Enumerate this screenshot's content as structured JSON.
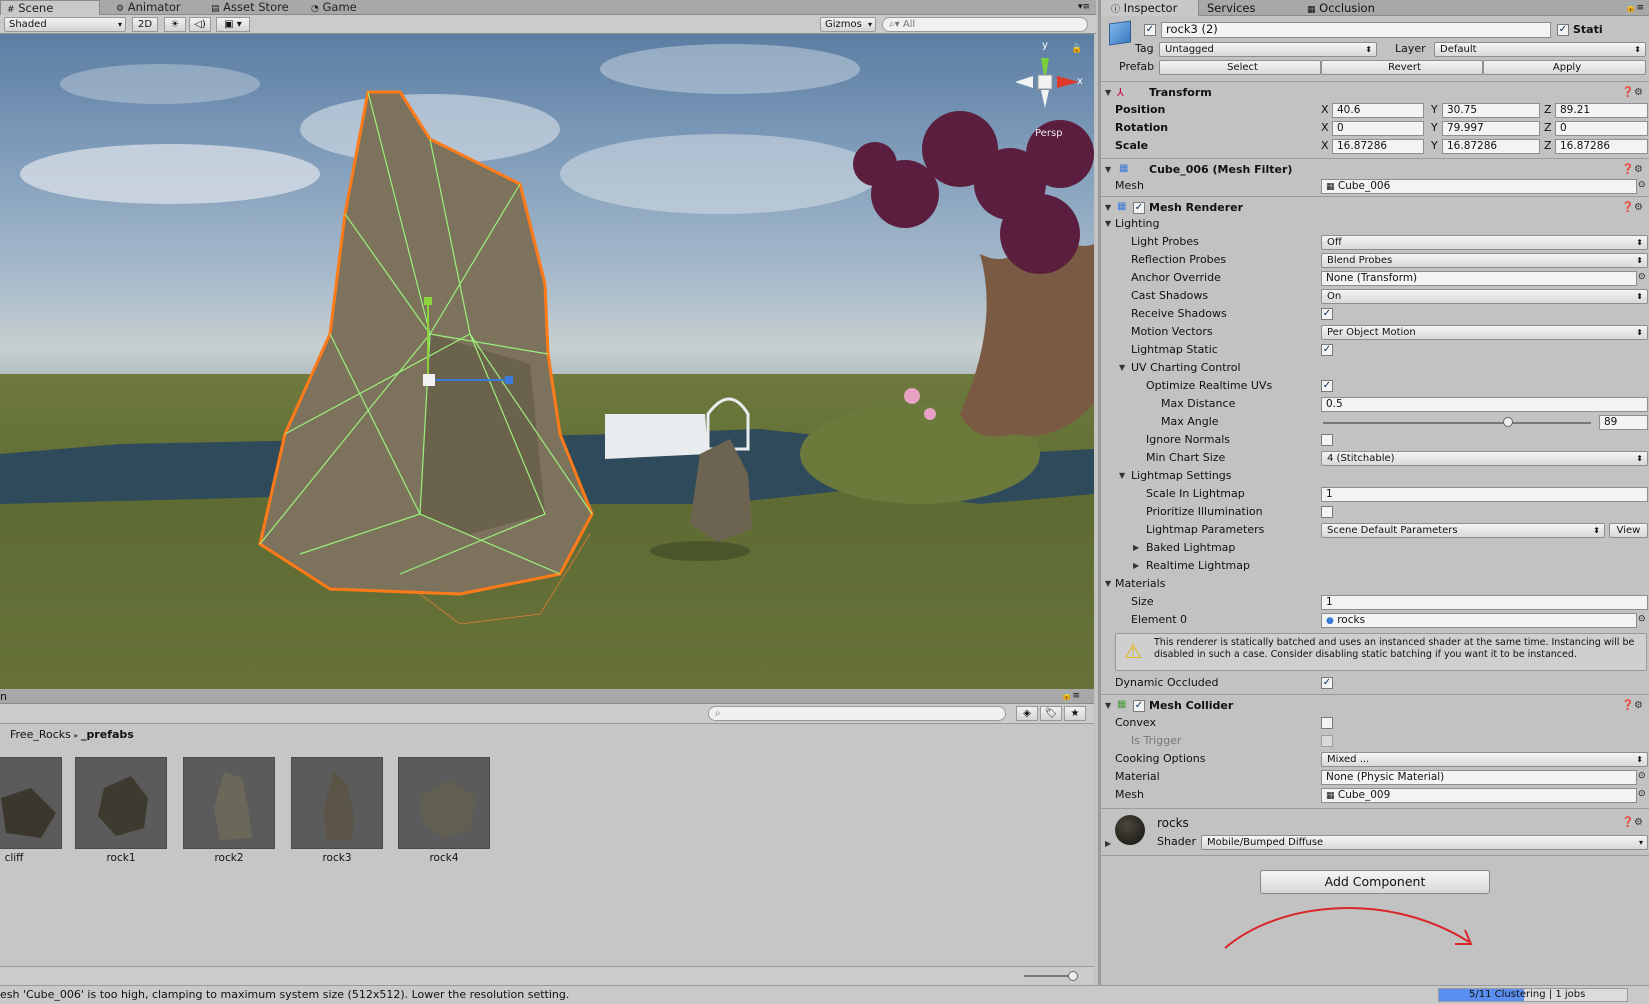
{
  "editor_tabs": {
    "scene": "Scene",
    "animator": "Animator",
    "asset_store": "Asset Store",
    "game": "Game"
  },
  "scene_toolbar": {
    "shading_mode": "Shaded",
    "mode_2d": "2D",
    "gizmos": "Gizmos",
    "search_placeholder": "All"
  },
  "viewport": {
    "persp_label": "Persp",
    "gizmo_axes": {
      "x": "x",
      "y": "y"
    }
  },
  "inspector_tabs": {
    "inspector": "Inspector",
    "services": "Services",
    "occlusion": "Occlusion"
  },
  "object": {
    "name": "rock3 (2)",
    "static_label": "Stati",
    "tag_label": "Tag",
    "tag": "Untagged",
    "layer_label": "Layer",
    "layer": "Default",
    "prefab_label": "Prefab",
    "prefab_select": "Select",
    "prefab_revert": "Revert",
    "prefab_apply": "Apply"
  },
  "transform": {
    "title": "Transform",
    "position_label": "Position",
    "position": {
      "x": "40.6",
      "y": "30.75",
      "z": "89.21"
    },
    "rotation_label": "Rotation",
    "rotation": {
      "x": "0",
      "y": "79.997",
      "z": "0"
    },
    "scale_label": "Scale",
    "scale": {
      "x": "16.87286",
      "y": "16.87286",
      "z": "16.87286"
    },
    "axis_x": "X",
    "axis_y": "Y",
    "axis_z": "Z"
  },
  "mesh_filter": {
    "title": "Cube_006 (Mesh Filter)",
    "mesh_label": "Mesh",
    "mesh": "Cube_006"
  },
  "mesh_renderer": {
    "title": "Mesh Renderer",
    "lighting": "Lighting",
    "light_probes_label": "Light Probes",
    "light_probes": "Off",
    "reflection_probes_label": "Reflection Probes",
    "reflection_probes": "Blend Probes",
    "anchor_override_label": "Anchor Override",
    "anchor_override": "None (Transform)",
    "cast_shadows_label": "Cast Shadows",
    "cast_shadows": "On",
    "receive_shadows_label": "Receive Shadows",
    "motion_vectors_label": "Motion Vectors",
    "motion_vectors": "Per Object Motion",
    "lightmap_static_label": "Lightmap Static",
    "uv_charting": "UV Charting Control",
    "optimize_uvs_label": "Optimize Realtime UVs",
    "max_distance_label": "Max Distance",
    "max_distance": "0.5",
    "max_angle_label": "Max Angle",
    "max_angle": "89",
    "max_angle_fraction": 0.69,
    "ignore_normals_label": "Ignore Normals",
    "min_chart_size_label": "Min Chart Size",
    "min_chart_size": "4 (Stitchable)",
    "lightmap_settings": "Lightmap Settings",
    "scale_in_lightmap_label": "Scale In Lightmap",
    "scale_in_lightmap": "1",
    "prioritize_label": "Prioritize Illumination",
    "lightmap_params_label": "Lightmap Parameters",
    "lightmap_params": "Scene Default Parameters",
    "view_button": "View",
    "baked_lightmap": "Baked Lightmap",
    "realtime_lightmap": "Realtime Lightmap",
    "materials": "Materials",
    "size_label": "Size",
    "size": "1",
    "element0_label": "Element 0",
    "element0": "rocks",
    "warning": "This renderer is statically batched and uses an instanced shader at the same time. Instancing will be disabled in such a case. Consider disabling static batching if you want it to be instanced.",
    "dynamic_occluded_label": "Dynamic Occluded"
  },
  "mesh_collider": {
    "title": "Mesh Collider",
    "convex_label": "Convex",
    "is_trigger_label": "Is Trigger",
    "cooking_label": "Cooking Options",
    "cooking": "Mixed ...",
    "material_label": "Material",
    "material": "None (Physic Material)",
    "mesh_label": "Mesh",
    "mesh": "Cube_009"
  },
  "material_section": {
    "name": "rocks",
    "shader_label": "Shader",
    "shader": "Mobile/Bumped Diffuse"
  },
  "add_component": "Add Component",
  "project": {
    "tab_fragment": "n",
    "breadcrumb_root": "Free_Rocks",
    "breadcrumb_current": "_prefabs",
    "assets": [
      "cliff",
      "rock1",
      "rock2",
      "rock3",
      "rock4"
    ]
  },
  "status": {
    "message": "esh 'Cube_006' is too high, clamping to maximum system size (512x512). Lower the resolution setting.",
    "progress": "5/11 Clustering | 1 jobs"
  },
  "colors": {
    "selection_outline": "#ff7a18",
    "wireframe": "#9cf07a",
    "progress_fill": "#5a8ef0",
    "annotation": "#d9262a"
  }
}
